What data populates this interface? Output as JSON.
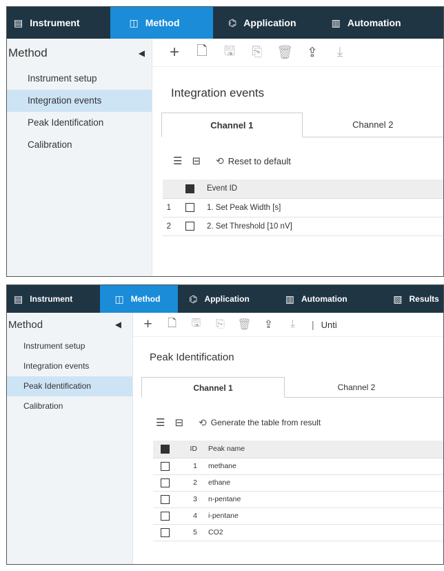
{
  "panel1": {
    "nav": [
      {
        "label": "Instrument",
        "icon": "instrument-icon",
        "glyph": "▤",
        "active": false
      },
      {
        "label": "Method",
        "icon": "method-icon",
        "glyph": "◫",
        "active": true
      },
      {
        "label": "Application",
        "icon": "application-icon",
        "glyph": "⌬",
        "active": false
      },
      {
        "label": "Automation",
        "icon": "automation-icon",
        "glyph": "▥",
        "active": false
      }
    ],
    "sidebar": {
      "title": "Method",
      "items": [
        "Instrument setup",
        "Integration events",
        "Peak Identification",
        "Calibration"
      ],
      "active_index": 1
    },
    "toolbar_icons": [
      "add-icon",
      "open-file-icon",
      "save-icon",
      "save-as-icon",
      "delete-icon",
      "export-icon",
      "import-icon"
    ],
    "title": "Integration events",
    "tabs": [
      "Channel 1",
      "Channel 2"
    ],
    "action_label": "Reset to default",
    "table": {
      "header": "Event ID",
      "rows": [
        {
          "num": "1",
          "label": "1. Set Peak Width [s]"
        },
        {
          "num": "2",
          "label": "2. Set Threshold [10 nV]"
        }
      ]
    }
  },
  "panel2": {
    "nav": [
      {
        "label": "Instrument",
        "icon": "instrument-icon",
        "glyph": "▤",
        "active": false
      },
      {
        "label": "Method",
        "icon": "method-icon",
        "glyph": "◫",
        "active": true
      },
      {
        "label": "Application",
        "icon": "application-icon",
        "glyph": "⌬",
        "active": false
      },
      {
        "label": "Automation",
        "icon": "automation-icon",
        "glyph": "▥",
        "active": false
      },
      {
        "label": "Results",
        "icon": "results-icon",
        "glyph": "▧",
        "active": false
      }
    ],
    "sidebar": {
      "title": "Method",
      "items": [
        "Instrument setup",
        "Integration events",
        "Peak Identification",
        "Calibration"
      ],
      "active_index": 2
    },
    "toolbar_name": "Unti",
    "title": "Peak Identification",
    "tabs": [
      "Channel 1",
      "Channel 2"
    ],
    "action_label": "Generate the table from result",
    "table": {
      "headers": [
        "ID",
        "Peak name"
      ],
      "rows": [
        {
          "id": "1",
          "name": "methane"
        },
        {
          "id": "2",
          "name": "ethane"
        },
        {
          "id": "3",
          "name": "n-pentane"
        },
        {
          "id": "4",
          "name": "i-pentane"
        },
        {
          "id": "5",
          "name": "CO2"
        }
      ]
    }
  },
  "colors": {
    "nav_bg": "#1f3544",
    "nav_active": "#1a8cd8",
    "sidebar_active": "#cde4f5"
  }
}
